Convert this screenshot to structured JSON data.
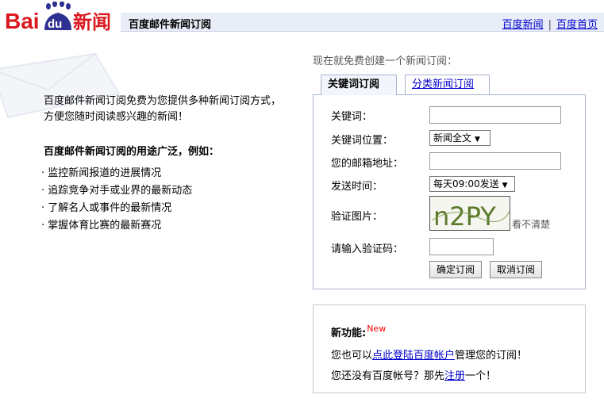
{
  "brand": {
    "logo_bai": "Bai",
    "logo_du": "du",
    "logo_news": "新闻"
  },
  "header": {
    "title": "百度邮件新闻订阅",
    "links": [
      "百度新闻",
      "百度首页"
    ],
    "separator": "|"
  },
  "intro": {
    "text": "百度邮件新闻订阅免费为您提供多种新闻订阅方式，方便您随时阅读感兴趣的新闻！",
    "uses_title": "百度邮件新闻订阅的用途广泛，例如：",
    "uses": [
      "监控新闻报道的进展情况",
      "追踪竞争对手或业界的最新动态",
      "了解名人或事件的最新情况",
      "掌握体育比赛的最新赛况"
    ]
  },
  "form": {
    "prompt": "现在就免费创建一个新闻订阅：",
    "tabs": [
      "关键词订阅",
      "分类新闻订阅"
    ],
    "labels": {
      "keyword": "关键词：",
      "position": "关键词位置：",
      "email": "您的邮箱地址：",
      "send_time": "发送时间：",
      "captcha": "验证图片：",
      "captcha_input": "请输入验证码："
    },
    "keyword_value": "",
    "email_value": "",
    "captcha_code_value": "",
    "position_selected": "新闻全文",
    "send_time_selected": "每天09:00发送",
    "captcha_text": "n2PY",
    "captcha_hint": "看不清楚",
    "buttons": {
      "confirm": "确定订阅",
      "cancel": "取消订阅"
    }
  },
  "news": {
    "title": "新功能:",
    "badge": "New",
    "line1_pre": "您也可以",
    "line1_link": "点此登陆百度帐户",
    "line1_post": "管理您的订阅！",
    "line2_pre": "您还没有百度帐号？那先",
    "line2_link": "注册",
    "line2_post": "一个！"
  },
  "colors": {
    "brand_red": "#d9191f",
    "brand_blue": "#2e3192",
    "header_bar": "#e8edf8",
    "link": "#0000cc",
    "new_badge": "#ff0000"
  }
}
